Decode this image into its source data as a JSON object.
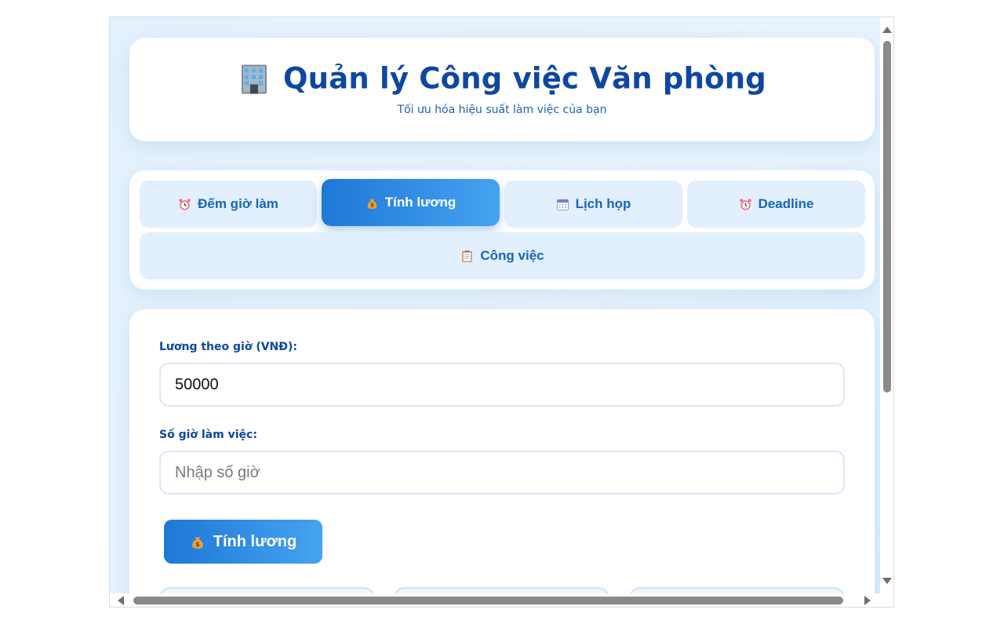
{
  "header": {
    "title": "Quản lý Công việc Văn phòng",
    "subtitle": "Tối ưu hóa hiệu suất làm việc của bạn",
    "icon": "office-building-icon"
  },
  "tabs": [
    {
      "label": "Đếm giờ làm",
      "icon": "alarm-clock-icon",
      "active": false
    },
    {
      "label": "Tính lương",
      "icon": "money-bag-icon",
      "active": true
    },
    {
      "label": "Lịch họp",
      "icon": "calendar-icon",
      "active": false
    },
    {
      "label": "Deadline",
      "icon": "alarm-clock-icon",
      "active": false
    },
    {
      "label": "Công việc",
      "icon": "clipboard-icon",
      "active": false
    }
  ],
  "form": {
    "hourly_wage_label": "Lương theo giờ (VNĐ):",
    "hourly_wage_value": "50000",
    "hours_label": "Số giờ làm việc:",
    "hours_placeholder": "Nhập số giờ",
    "hours_value": "",
    "calculate_label": "Tính lương"
  },
  "colors": {
    "primary": "#1565c0",
    "title": "#0d47a1",
    "accent_start": "#1e78d6",
    "accent_end": "#45a3f0",
    "background": "#e3f1fd"
  }
}
